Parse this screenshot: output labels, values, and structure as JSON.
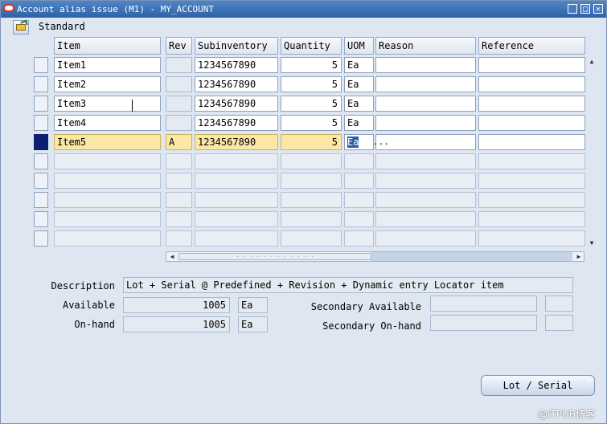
{
  "window": {
    "title": "Account alias issue (M1) - MY_ACCOUNT",
    "buttons": {
      "minimize": "_",
      "maximize": "□",
      "close": "✕"
    }
  },
  "toolbar": {
    "folder_label": "Standard",
    "folder_icon": "folder-icon"
  },
  "table": {
    "headers": {
      "item": "Item",
      "rev": "Rev",
      "subinventory": "Subinventory",
      "quantity": "Quantity",
      "uom": "UOM",
      "reason": "Reason",
      "reference": "Reference"
    },
    "rows": [
      {
        "item": "Item1",
        "rev": "",
        "subinventory": "1234567890",
        "quantity": "5",
        "uom": "Ea",
        "reason": "",
        "reference": ""
      },
      {
        "item": "Item2",
        "rev": "",
        "subinventory": "1234567890",
        "quantity": "5",
        "uom": "Ea",
        "reason": "",
        "reference": ""
      },
      {
        "item": "Item3",
        "rev": "",
        "subinventory": "1234567890",
        "quantity": "5",
        "uom": "Ea",
        "reason": "",
        "reference": ""
      },
      {
        "item": "Item4",
        "rev": "",
        "subinventory": "1234567890",
        "quantity": "5",
        "uom": "Ea",
        "reason": "",
        "reference": ""
      },
      {
        "item": "Item5",
        "rev": "A",
        "subinventory": "1234567890",
        "quantity": "5",
        "uom": "Ea",
        "reason": "",
        "reference": ""
      }
    ],
    "lov_label": "..."
  },
  "details": {
    "description_label": "Description",
    "description_value": "Lot + Serial @ Predefined + Revision + Dynamic entry Locator item",
    "available_label": "Available",
    "available_value": "1005",
    "available_uom": "Ea",
    "onhand_label": "On-hand",
    "onhand_value": "1005",
    "onhand_uom": "Ea",
    "sec_available_label": "Secondary Available",
    "sec_onhand_label": "Secondary On-hand"
  },
  "actions": {
    "lot_serial": "Lot / Serial"
  },
  "watermark": "@ITPUB博客",
  "colors": {
    "titlebar": "#2f62a5",
    "current_row": "#fbe8a6",
    "selected_text": "#2b5aa5",
    "row_indicator": "#0d1f70"
  }
}
